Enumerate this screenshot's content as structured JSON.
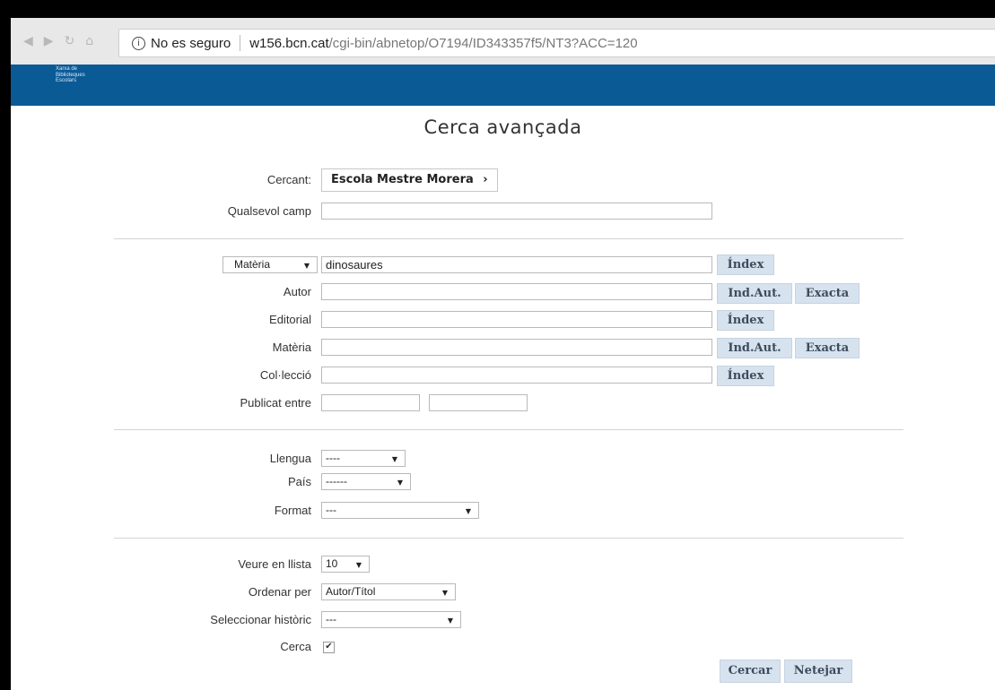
{
  "browser": {
    "security_label": "No es seguro",
    "url_host": "w156.bcn.cat",
    "url_path": "/cgi-bin/abnetop/O7194/ID343357f5/NT3?ACC=120"
  },
  "header": {
    "logo_line1": "Xarxa de",
    "logo_line2": "Biblioteques",
    "logo_line3": "Escolars"
  },
  "page": {
    "title": "Cerca avançada"
  },
  "cercant": {
    "label": "Cercant:",
    "value": "Escola Mestre Morera",
    "chevron": "›"
  },
  "qualsevol": {
    "label": "Qualsevol camp",
    "value": ""
  },
  "fields": {
    "field_select": "Matèria",
    "field_select_value": "dinosaures",
    "index_label": "Índex",
    "indaut_label": "Ind.Aut.",
    "exacta_label": "Exacta",
    "autor": "Autor",
    "editorial": "Editorial",
    "materia": "Matèria",
    "colleccio": "Col·lecció",
    "publicat": "Publicat entre"
  },
  "filters": {
    "llengua_label": "Llengua",
    "llengua_value": "----",
    "pais_label": "País",
    "pais_value": "------",
    "format_label": "Format",
    "format_value": "---"
  },
  "display": {
    "veure_label": "Veure en llista",
    "veure_value": "10",
    "ordenar_label": "Ordenar per",
    "ordenar_value": "Autor/Títol",
    "historic_label": "Seleccionar històric",
    "historic_value": "---",
    "cerca_label": "Cerca",
    "cerca_checked": "✔"
  },
  "actions": {
    "cercar": "Cercar",
    "netejar": "Netejar"
  },
  "icons": {
    "info": "i",
    "dropdown": "▼"
  }
}
